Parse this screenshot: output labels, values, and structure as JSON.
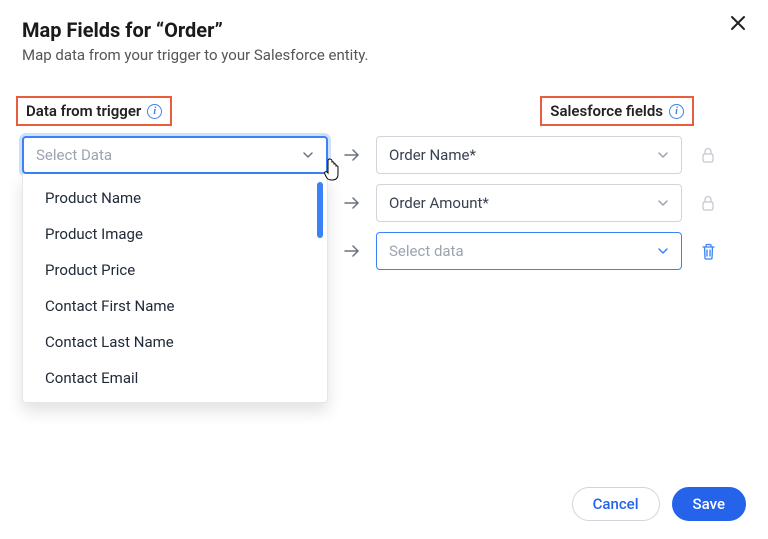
{
  "header": {
    "title": "Map Fields for “Order”",
    "subtitle": "Map data from your trigger to your Salesforce entity."
  },
  "columns": {
    "left_label": "Data from trigger",
    "right_label": "Salesforce fields"
  },
  "left_select": {
    "placeholder": "Select Data"
  },
  "dropdown_options": [
    "Product Name",
    "Product Image",
    "Product Price",
    "Contact First Name",
    "Contact Last Name",
    "Contact Email"
  ],
  "right_rows": [
    {
      "label": "Order Name*",
      "locked": true
    },
    {
      "label": "Order Amount*",
      "locked": true
    },
    {
      "label": "Select data",
      "locked": false,
      "placeholder": true,
      "active": true
    }
  ],
  "footer": {
    "cancel": "Cancel",
    "save": "Save"
  }
}
